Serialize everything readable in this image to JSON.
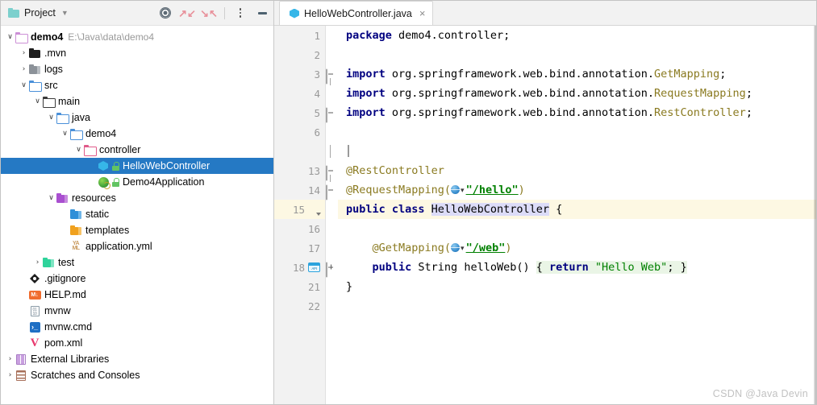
{
  "project_panel": {
    "title": "Project",
    "icons": {
      "folder": "folder-icon",
      "chevron": "chevron-down-icon",
      "locate": "target-locate-icon",
      "expand_all": "expand-all-icon",
      "collapse_all": "collapse-all-icon",
      "options": "more-options-icon",
      "hide": "minimize-icon"
    },
    "tree": [
      {
        "label": "demo4",
        "path": "E:\\Java\\data\\demo4",
        "twisty": "v",
        "indent": 0,
        "icon": "folder-outline-purple-icon",
        "bold": true,
        "lock": false,
        "selected": false
      },
      {
        "label": ".mvn",
        "path": "",
        "twisty": ">",
        "indent": 1,
        "icon": "folder-dark-icon",
        "bold": false,
        "lock": false,
        "selected": false
      },
      {
        "label": "logs",
        "path": "",
        "twisty": ">",
        "indent": 1,
        "icon": "folder-grey-icon",
        "bold": false,
        "lock": false,
        "selected": false
      },
      {
        "label": "src",
        "path": "",
        "twisty": "v",
        "indent": 1,
        "icon": "folder-source-icon",
        "bold": false,
        "lock": false,
        "selected": false
      },
      {
        "label": "main",
        "path": "",
        "twisty": "v",
        "indent": 2,
        "icon": "folder-outline-dark-icon",
        "bold": false,
        "lock": false,
        "selected": false
      },
      {
        "label": "java",
        "path": "",
        "twisty": "v",
        "indent": 3,
        "icon": "folder-outline-blue-icon",
        "bold": false,
        "lock": false,
        "selected": false
      },
      {
        "label": "demo4",
        "path": "",
        "twisty": "v",
        "indent": 4,
        "icon": "folder-outline-blue-icon",
        "bold": false,
        "lock": false,
        "selected": false
      },
      {
        "label": "controller",
        "path": "",
        "twisty": "v",
        "indent": 5,
        "icon": "folder-outline-pink-icon",
        "bold": false,
        "lock": false,
        "selected": false
      },
      {
        "label": "HelloWebController",
        "path": "",
        "twisty": "",
        "indent": 6,
        "icon": "java-class-icon",
        "bold": false,
        "lock": true,
        "selected": true
      },
      {
        "label": "Demo4Application",
        "path": "",
        "twisty": "",
        "indent": 6,
        "icon": "spring-boot-class-icon",
        "bold": false,
        "lock": true,
        "selected": false
      },
      {
        "label": "resources",
        "path": "",
        "twisty": "v",
        "indent": 3,
        "icon": "folder-resources-purple-icon",
        "bold": false,
        "lock": false,
        "selected": false
      },
      {
        "label": "static",
        "path": "",
        "twisty": "",
        "indent": 4,
        "icon": "folder-static-blue-icon",
        "bold": false,
        "lock": false,
        "selected": false
      },
      {
        "label": "templates",
        "path": "",
        "twisty": "",
        "indent": 4,
        "icon": "folder-templates-orange-icon",
        "bold": false,
        "lock": false,
        "selected": false
      },
      {
        "label": "application.yml",
        "path": "",
        "twisty": "",
        "indent": 4,
        "icon": "yaml-file-icon",
        "bold": false,
        "lock": false,
        "selected": false
      },
      {
        "label": "test",
        "path": "",
        "twisty": ">",
        "indent": 2,
        "icon": "folder-test-green-icon",
        "bold": false,
        "lock": false,
        "selected": false
      },
      {
        "label": ".gitignore",
        "path": "",
        "twisty": "",
        "indent": 1,
        "icon": "git-file-icon",
        "bold": false,
        "lock": false,
        "selected": false
      },
      {
        "label": "HELP.md",
        "path": "",
        "twisty": "",
        "indent": 1,
        "icon": "markdown-file-icon",
        "bold": false,
        "lock": false,
        "selected": false
      },
      {
        "label": "mvnw",
        "path": "",
        "twisty": "",
        "indent": 1,
        "icon": "binary-file-icon",
        "bold": false,
        "lock": false,
        "selected": false
      },
      {
        "label": "mvnw.cmd",
        "path": "",
        "twisty": "",
        "indent": 1,
        "icon": "cmd-file-icon",
        "bold": false,
        "lock": false,
        "selected": false
      },
      {
        "label": "pom.xml",
        "path": "",
        "twisty": "",
        "indent": 1,
        "icon": "maven-file-icon",
        "bold": false,
        "lock": false,
        "selected": false
      },
      {
        "label": "External Libraries",
        "path": "",
        "twisty": ">",
        "indent": 0,
        "icon": "external-libraries-icon",
        "bold": false,
        "lock": false,
        "selected": false
      },
      {
        "label": "Scratches and Consoles",
        "path": "",
        "twisty": ">",
        "indent": 0,
        "icon": "scratches-icon",
        "bold": false,
        "lock": false,
        "selected": false
      }
    ]
  },
  "editor": {
    "tab": {
      "label": "HelloWebController.java",
      "icon": "java-class-icon",
      "close": "×"
    },
    "lines": [
      {
        "num": "1",
        "gutter_icon": "",
        "fold": "collapse-start-hidden",
        "current": false,
        "tokens": [
          {
            "t": "package ",
            "c": "kw"
          },
          {
            "t": "demo4.controller;",
            "c": "txt"
          }
        ]
      },
      {
        "num": "2",
        "gutter_icon": "",
        "fold": "",
        "current": false,
        "tokens": []
      },
      {
        "num": "3",
        "gutter_icon": "",
        "fold": "collapse-top",
        "current": false,
        "tokens": [
          {
            "t": "import ",
            "c": "kw"
          },
          {
            "t": "org.springframework.web.bind.annotation.",
            "c": "txt"
          },
          {
            "t": "GetMapping",
            "c": "cls"
          },
          {
            "t": ";",
            "c": "txt"
          }
        ]
      },
      {
        "num": "4",
        "gutter_icon": "",
        "fold": "",
        "current": false,
        "tokens": [
          {
            "t": "import ",
            "c": "kw"
          },
          {
            "t": "org.springframework.web.bind.annotation.",
            "c": "txt"
          },
          {
            "t": "RequestMapping",
            "c": "cls"
          },
          {
            "t": ";",
            "c": "txt"
          }
        ]
      },
      {
        "num": "5",
        "gutter_icon": "",
        "fold": "collapse-bottom",
        "current": false,
        "tokens": [
          {
            "t": "import ",
            "c": "kw"
          },
          {
            "t": "org.springframework.web.bind.annotation.",
            "c": "txt"
          },
          {
            "t": "RestController",
            "c": "cls"
          },
          {
            "t": ";",
            "c": "txt"
          }
        ]
      },
      {
        "num": "6",
        "gutter_icon": "",
        "fold": "",
        "current": false,
        "tokens": []
      },
      {
        "num": "",
        "gutter_icon": "",
        "fold": "folded-region",
        "current": false,
        "tokens": []
      },
      {
        "num": "13",
        "gutter_icon": "",
        "fold": "collapse-top",
        "current": false,
        "tokens": [
          {
            "t": "@RestController",
            "c": "ann"
          }
        ]
      },
      {
        "num": "14",
        "gutter_icon": "",
        "fold": "collapse-bottom",
        "current": false,
        "tokens": [
          {
            "t": "@RequestMapping(",
            "c": "ann"
          },
          {
            "t": "__GLOBE__",
            "c": "globe"
          },
          {
            "t": "\"/hello\"",
            "c": "strU"
          },
          {
            "t": ")",
            "c": "ann"
          }
        ]
      },
      {
        "num": "15",
        "gutter_icon": "spring-bean-icon",
        "fold": "",
        "current": true,
        "tokens": [
          {
            "t": "public class ",
            "c": "kw"
          },
          {
            "t": "HelloWebController",
            "c": "hl-ident"
          },
          {
            "t": " {",
            "c": "txt"
          }
        ]
      },
      {
        "num": "16",
        "gutter_icon": "",
        "fold": "",
        "current": false,
        "tokens": []
      },
      {
        "num": "17",
        "gutter_icon": "",
        "fold": "",
        "current": false,
        "tokens": [
          {
            "t": "    @GetMapping(",
            "c": "ann"
          },
          {
            "t": "__GLOBE__",
            "c": "globe"
          },
          {
            "t": "\"/web\"",
            "c": "strU"
          },
          {
            "t": ")",
            "c": "ann"
          }
        ]
      },
      {
        "num": "18",
        "gutter_icon": "api-endpoint-icon",
        "fold": "expand-plus",
        "current": false,
        "tokens": [
          {
            "t": "    public ",
            "c": "kw"
          },
          {
            "t": "String",
            "c": "txt"
          },
          {
            "t": " helloWeb() ",
            "c": "txt"
          },
          {
            "t": "{ ",
            "c": "fold-open"
          },
          {
            "t": "return ",
            "c": "kw-fold"
          },
          {
            "t": "\"Hello Web\"",
            "c": "str-fold"
          },
          {
            "t": "; }",
            "c": "fold-close"
          }
        ]
      },
      {
        "num": "21",
        "gutter_icon": "",
        "fold": "",
        "current": false,
        "tokens": [
          {
            "t": "}",
            "c": "txt"
          }
        ]
      },
      {
        "num": "22",
        "gutter_icon": "",
        "fold": "",
        "current": false,
        "tokens": []
      }
    ]
  },
  "watermark": "CSDN @Java Devin"
}
